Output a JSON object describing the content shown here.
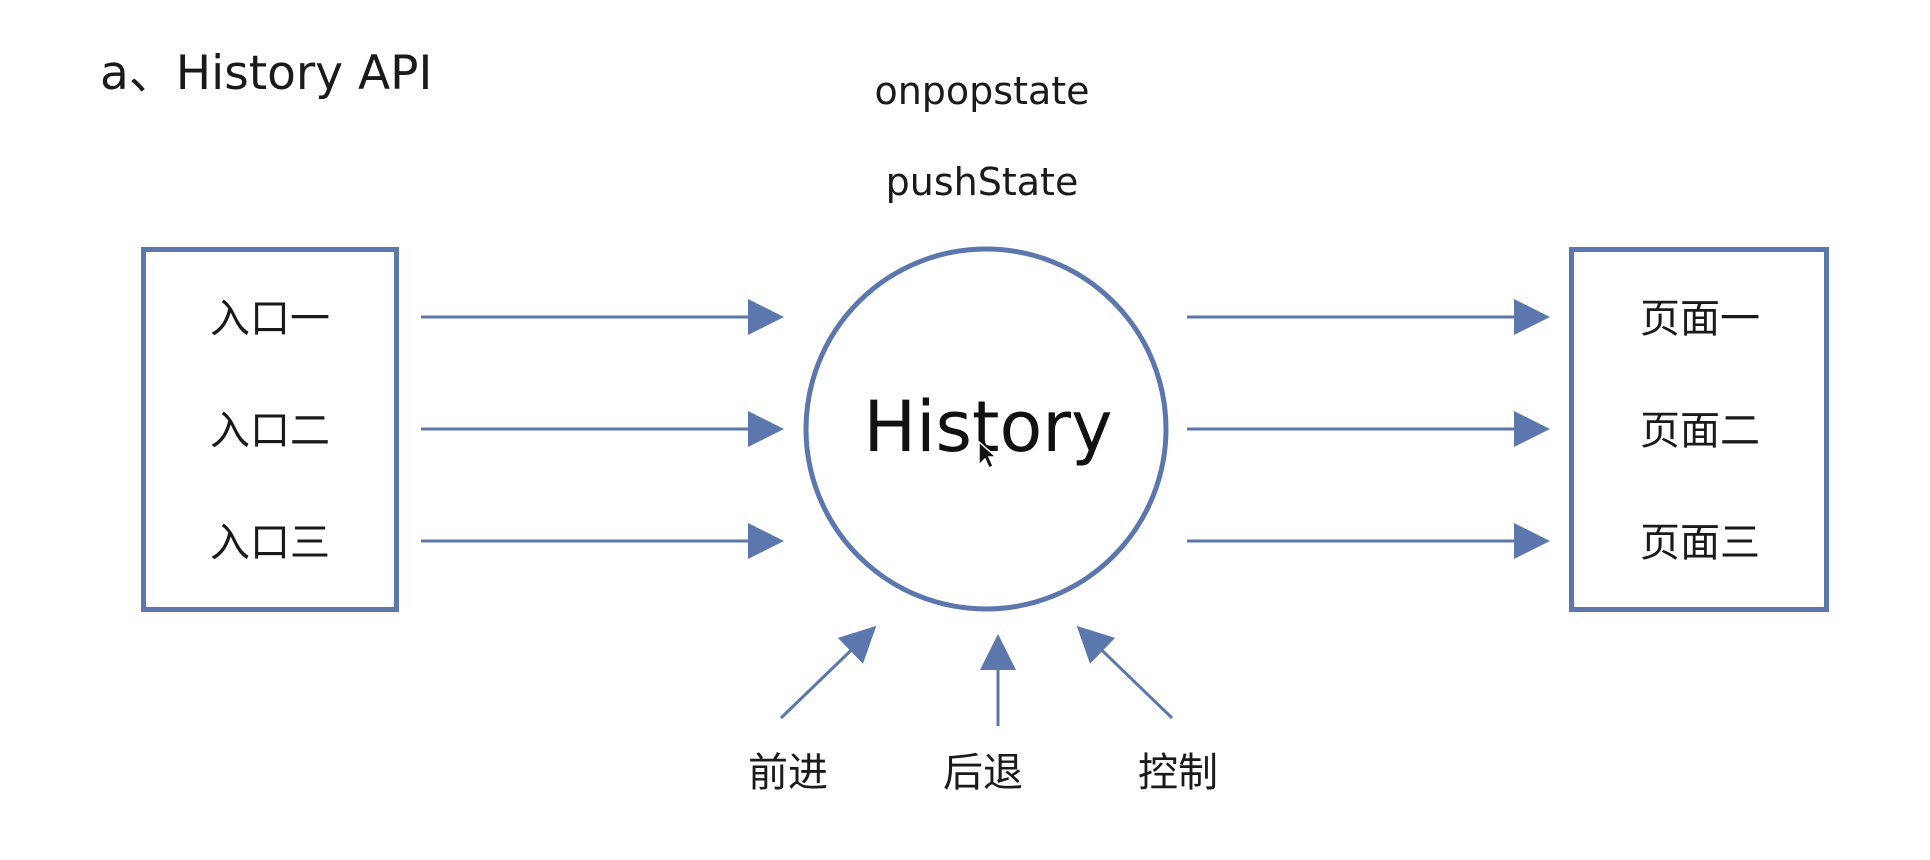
{
  "title": "a、History API",
  "api_methods": [
    "onpopstate",
    "pushState"
  ],
  "center_label": "History",
  "entries": [
    "入口一",
    "入口二",
    "入口三"
  ],
  "pages": [
    "页面一",
    "页面二",
    "页面三"
  ],
  "controls": [
    "前进",
    "后退",
    "控制"
  ],
  "colors": {
    "stroke": "#5c77ad",
    "text": "#1a1a1a"
  },
  "icons": {
    "cursor": "mouse-pointer-icon"
  }
}
